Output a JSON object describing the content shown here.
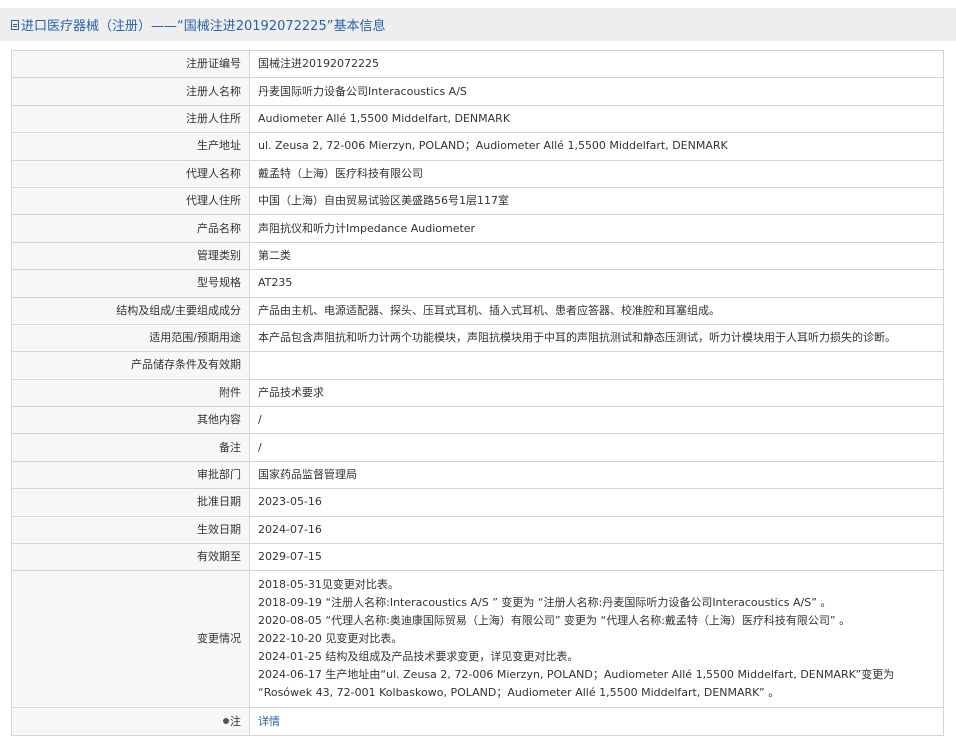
{
  "page_title": "进口医疗器械（注册）——“国械注进20192072225”基本信息",
  "rows": [
    {
      "label": "注册证编号",
      "value": "国械注进20192072225"
    },
    {
      "label": "注册人名称",
      "value": "丹麦国际听力设备公司Interacoustics A/S"
    },
    {
      "label": "注册人住所",
      "value": "Audiometer Allé 1,5500 Middelfart, DENMARK"
    },
    {
      "label": "生产地址",
      "value": "ul. Zeusa 2, 72-006 Mierzyn, POLAND；Audiometer Allé 1,5500 Middelfart, DENMARK"
    },
    {
      "label": "代理人名称",
      "value": "戴孟特（上海）医疗科技有限公司"
    },
    {
      "label": "代理人住所",
      "value": "中国（上海）自由贸易试验区美盛路56号1层117室"
    },
    {
      "label": "产品名称",
      "value": "声阻抗仪和听力计Impedance Audiometer"
    },
    {
      "label": "管理类别",
      "value": "第二类"
    },
    {
      "label": "型号规格",
      "value": "AT235"
    },
    {
      "label": "结构及组成/主要组成成分",
      "value": "产品由主机、电源适配器、探头、压耳式耳机、插入式耳机、患者应答器、校准腔和耳塞组成。"
    },
    {
      "label": "适用范围/预期用途",
      "value": "本产品包含声阻抗和听力计两个功能模块，声阻抗模块用于中耳的声阻抗测试和静态压测试，听力计模块用于人耳听力损失的诊断。"
    },
    {
      "label": "产品储存条件及有效期",
      "value": ""
    },
    {
      "label": "附件",
      "value": "产品技术要求"
    },
    {
      "label": "其他内容",
      "value": "/"
    },
    {
      "label": "备注",
      "value": "/"
    },
    {
      "label": "审批部门",
      "value": "国家药品监督管理局"
    },
    {
      "label": "批准日期",
      "value": "2023-05-16"
    },
    {
      "label": "生效日期",
      "value": "2024-07-16"
    },
    {
      "label": "有效期至",
      "value": "2029-07-15"
    }
  ],
  "changes": {
    "label": "变更情况",
    "lines": [
      "2018-05-31见变更对比表。",
      "2018-09-19 “注册人名称:Interacoustics A/S ” 变更为 “注册人名称:丹麦国际听力设备公司Interacoustics A/S” 。",
      "2020-08-05 “代理人名称:奥迪康国际贸易（上海）有限公司” 变更为 “代理人名称:戴孟特（上海）医疗科技有限公司” 。",
      "2022-10-20 见变更对比表。",
      "2024-01-25 结构及组成及产品技术要求变更，详见变更对比表。",
      "2024-06-17 生产地址由“ul. Zeusa 2, 72-006 Mierzyn, POLAND；Audiometer Allé 1,5500 Middelfart, DENMARK”变更为 “Rosówek 43, 72-001 Kolbaskowo, POLAND；Audiometer Allé 1,5500 Middelfart, DENMARK” 。"
    ]
  },
  "note_row": {
    "label": "注",
    "link": "详情"
  },
  "icons": {
    "title": "document-icon",
    "note": "pin-icon"
  },
  "colors": {
    "link": "#2a62a8",
    "header_bg": "#eeeeee",
    "label_bg": "#f7f7f7",
    "border": "#d5d5d5"
  }
}
